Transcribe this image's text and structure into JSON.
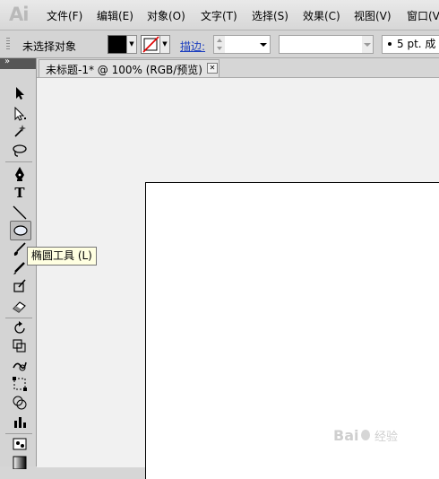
{
  "app": {
    "logo_text": "Ai"
  },
  "menu": {
    "items": [
      {
        "label": "文件(F)"
      },
      {
        "label": "编辑(E)"
      },
      {
        "label": "对象(O)"
      },
      {
        "label": "文字(T)"
      },
      {
        "label": "选择(S)"
      },
      {
        "label": "效果(C)"
      },
      {
        "label": "视图(V)"
      },
      {
        "label": "窗口(V"
      }
    ]
  },
  "control_bar": {
    "status": "未选择对象",
    "fill_color": "#000000",
    "stroke_label": "描边:",
    "brush_label": "5 pt. 成"
  },
  "toolbox": {
    "collapse_glyph": "»",
    "tools": [
      {
        "name": "selection-tool",
        "icon": "selection-arrow-icon"
      },
      {
        "name": "direct-selection-tool",
        "icon": "direct-selection-icon"
      },
      {
        "name": "magic-wand-tool",
        "icon": "magic-wand-icon"
      },
      {
        "name": "lasso-tool",
        "icon": "lasso-icon"
      },
      {
        "name": "pen-tool",
        "icon": "pen-icon"
      },
      {
        "name": "type-tool",
        "icon": "type-icon",
        "glyph": "T"
      },
      {
        "name": "line-segment-tool",
        "icon": "line-segment-icon"
      },
      {
        "name": "ellipse-tool",
        "icon": "ellipse-icon",
        "active": true
      },
      {
        "name": "paintbrush-tool",
        "icon": "paintbrush-icon"
      },
      {
        "name": "pencil-tool",
        "icon": "pencil-icon"
      },
      {
        "name": "blob-brush-tool",
        "icon": "blob-brush-icon"
      },
      {
        "name": "eraser-tool",
        "icon": "eraser-icon"
      },
      {
        "name": "rotate-tool",
        "icon": "rotate-icon"
      },
      {
        "name": "scale-tool",
        "icon": "scale-icon"
      },
      {
        "name": "warp-tool",
        "icon": "warp-icon"
      },
      {
        "name": "free-transform-tool",
        "icon": "free-transform-icon"
      },
      {
        "name": "shape-builder-tool",
        "icon": "shape-builder-icon"
      },
      {
        "name": "graph-tool",
        "icon": "graph-icon"
      },
      {
        "name": "symbol-sprayer-tool",
        "icon": "symbol-sprayer-icon"
      },
      {
        "name": "gradient-tool",
        "icon": "gradient-icon"
      }
    ]
  },
  "document": {
    "tab_label": "未标题-1* @ 100% (RGB/预览)",
    "close_glyph": "✕"
  },
  "tooltip": {
    "text": "椭圆工具 (L)"
  },
  "watermark": {
    "text": "Bai 经验"
  }
}
